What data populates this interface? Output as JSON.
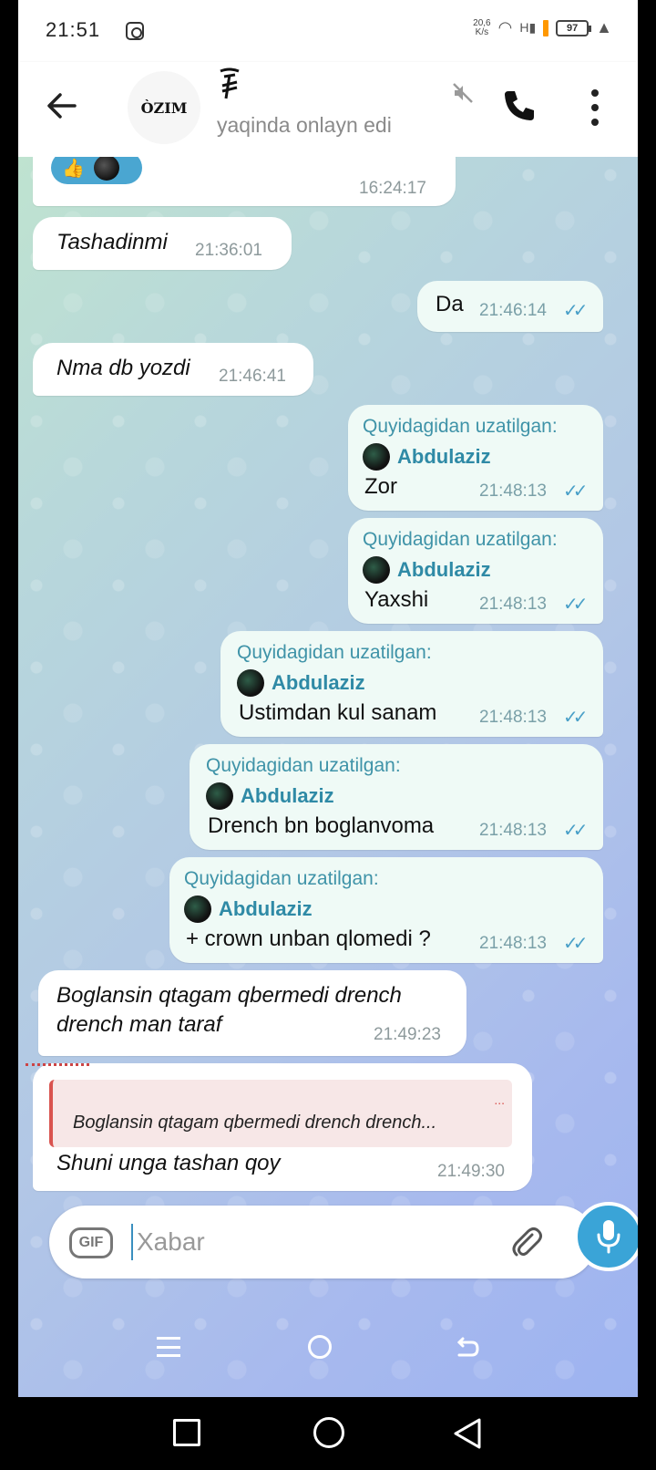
{
  "statusbar": {
    "time": "21:51",
    "speed_value": "20,6",
    "speed_unit": "K/s",
    "battery": "97"
  },
  "header": {
    "avatar_text": "ÒZIM",
    "contact_deco": "𝕿",
    "status": "yaqinda onlayn edi"
  },
  "messages": [
    {
      "dir": "in",
      "reactions": [
        "thumbs-up",
        "avatar"
      ],
      "time": "16:24:17"
    },
    {
      "dir": "in",
      "text": "Tashadinmi",
      "time": "21:36:01"
    },
    {
      "dir": "out",
      "text": "Da",
      "time": "21:46:14"
    },
    {
      "dir": "in",
      "text": "Nma db yozdi",
      "time": "21:46:41"
    },
    {
      "dir": "out",
      "forward_label": "Quyidagidan uzatilgan:",
      "forward_author": "Abdulaziz",
      "text": "Zor",
      "time": "21:48:13"
    },
    {
      "dir": "out",
      "forward_label": "Quyidagidan uzatilgan:",
      "forward_author": "Abdulaziz",
      "text": "Yaxshi",
      "time": "21:48:13"
    },
    {
      "dir": "out",
      "forward_label": "Quyidagidan uzatilgan:",
      "forward_author": "Abdulaziz",
      "text": "Ustimdan kul sanam",
      "time": "21:48:13"
    },
    {
      "dir": "out",
      "forward_label": "Quyidagidan uzatilgan:",
      "forward_author": "Abdulaziz",
      "text": "Drench bn boglanvoma",
      "time": "21:48:13"
    },
    {
      "dir": "out",
      "forward_label": "Quyidagidan uzatilgan:",
      "forward_author": "Abdulaziz",
      "text": "+ crown unban qlomedi ?",
      "time": "21:48:13"
    },
    {
      "dir": "in",
      "text_line1": "Boglansin qtagam qbermedi drench",
      "text_line2": "drench man taraf",
      "time": "21:49:23"
    },
    {
      "dir": "in",
      "reply_text": "Boglansin qtagam qbermedi drench drench...",
      "reply_dots": "...",
      "text": "Shuni unga tashan qoy",
      "time": "21:49:30"
    }
  ],
  "composer": {
    "gif_label": "GIF",
    "placeholder": "Xabar"
  },
  "colors": {
    "accent": "#3aa4d7",
    "forward_title": "#3f93a8",
    "check": "#4aa0c8"
  }
}
